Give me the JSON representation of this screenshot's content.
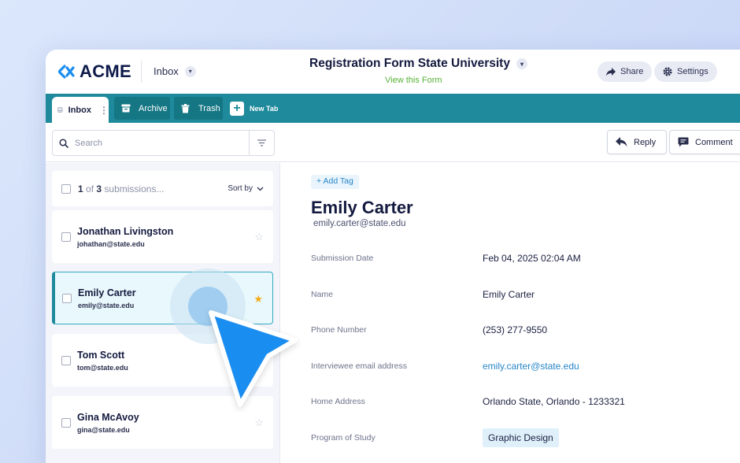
{
  "app": {
    "logo_text": "ACME",
    "inbox_label": "Inbox",
    "form_title": "Registration Form State University",
    "form_link": "View this Form",
    "share_label": "Share",
    "settings_label": "Settings"
  },
  "tabs": [
    {
      "label": "Inbox",
      "icon": "inbox-icon",
      "active": true
    },
    {
      "label": "Archive",
      "icon": "archive-icon"
    },
    {
      "label": "Trash",
      "icon": "trash-icon"
    },
    {
      "label": "New Tab",
      "icon": "plus-icon"
    }
  ],
  "search": {
    "placeholder": "Search"
  },
  "actions": {
    "reply_label": "Reply",
    "comment_label": "Comment"
  },
  "list": {
    "current": "1",
    "of_label": "of",
    "total": "3",
    "suffix": "submissions...",
    "sort_label": "Sort by",
    "items": [
      {
        "name": "Jonathan Livingston",
        "email": "johathan@state.edu",
        "starred": false
      },
      {
        "name": "Emily Carter",
        "email": "emily@state.edu",
        "starred": true,
        "selected": true
      },
      {
        "name": "Tom Scott",
        "email": "tom@state.edu",
        "starred": false
      },
      {
        "name": "Gina McAvoy",
        "email": "gina@state.edu",
        "starred": false
      }
    ]
  },
  "detail": {
    "add_tag": "+ Add Tag",
    "name": "Emily Carter",
    "email": "emily.carter@state.edu",
    "fields": [
      {
        "label": "Submission Date",
        "value": "Feb 04, 2025 02:04 AM"
      },
      {
        "label": "Name",
        "value": "Emily Carter"
      },
      {
        "label": "Phone Number",
        "value": "(253) 277-9550"
      },
      {
        "label": "Interviewee email address",
        "value": "emily.carter@state.edu"
      },
      {
        "label": "Home Address",
        "value": "Orlando State, Orlando - 1233321"
      },
      {
        "label": "Program of Study",
        "value": "Graphic Design"
      }
    ]
  },
  "colors": {
    "teal": "#1e8a9c",
    "link": "#2786c8",
    "green": "#58b237",
    "star": "#f2ac1c",
    "cursor": "#1a8df0"
  }
}
